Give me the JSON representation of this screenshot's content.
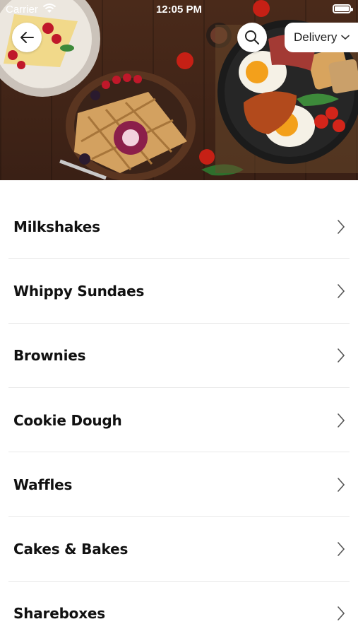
{
  "status_bar": {
    "carrier": "Carrier",
    "time": "12:05 PM"
  },
  "header": {
    "delivery_label": "Delivery"
  },
  "categories": [
    {
      "label": "Milkshakes"
    },
    {
      "label": "Whippy Sundaes"
    },
    {
      "label": "Brownies"
    },
    {
      "label": "Cookie Dough"
    },
    {
      "label": "Waffles"
    },
    {
      "label": "Cakes & Bakes"
    },
    {
      "label": "Shareboxes"
    }
  ],
  "icons": {
    "back": "arrow-left-icon",
    "search": "search-icon",
    "dropdown": "chevron-down-icon",
    "row": "chevron-right-icon"
  },
  "colors": {
    "text": "#111111",
    "divider": "#e9e9e9",
    "hero_wood": "#4a2a1a"
  }
}
